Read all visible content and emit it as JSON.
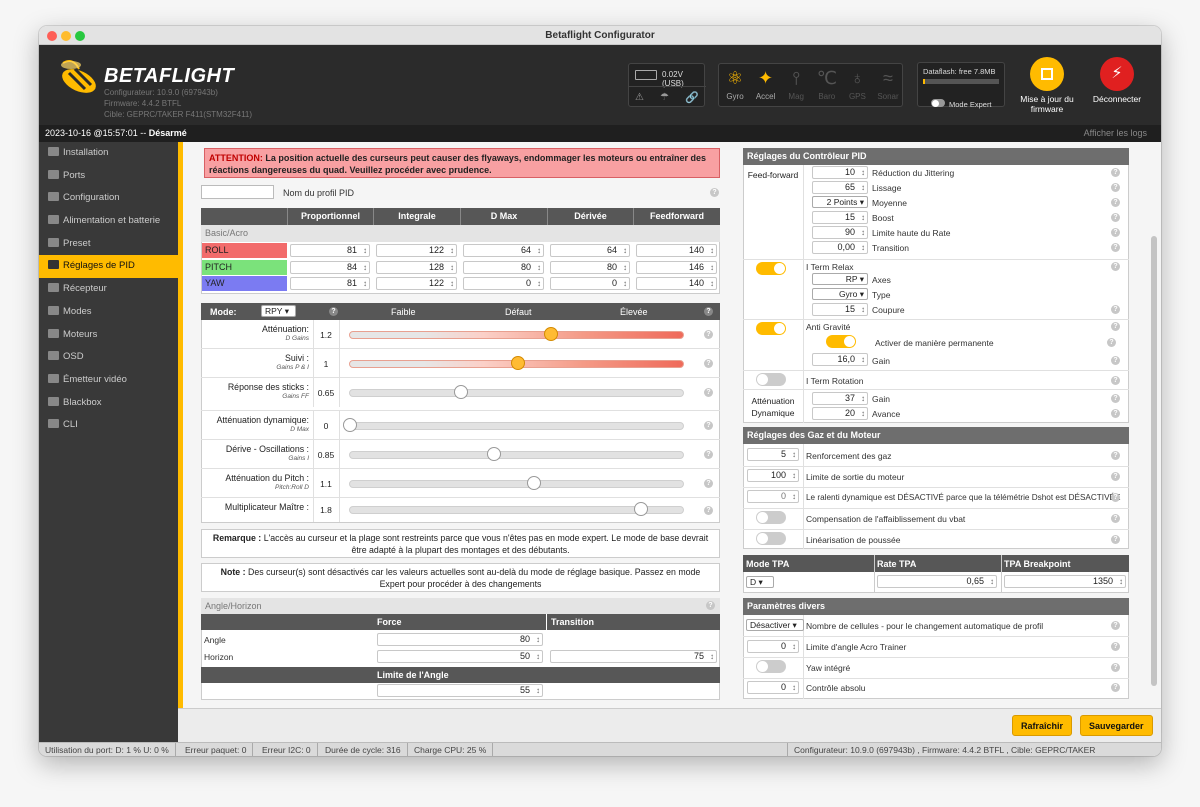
{
  "window": {
    "title": "Betaflight Configurator"
  },
  "header": {
    "logo": "BETAFLIGHT",
    "configurator": "Configurateur: 10.9.0 (697943b)",
    "firmware": "Firmware: 4.4.2 BTFL",
    "target": "Cible: GEPRC/TAKER F411(STM32F411)",
    "battery": "0.02V (USB)",
    "sensors": [
      {
        "label": "Gyro",
        "icon": "gyro-icon",
        "active": true
      },
      {
        "label": "Accel",
        "icon": "accel-icon",
        "active": true
      },
      {
        "label": "Mag",
        "icon": "mag-icon",
        "active": false
      },
      {
        "label": "Baro",
        "icon": "baro-icon",
        "active": false
      },
      {
        "label": "GPS",
        "icon": "gps-icon",
        "active": false
      },
      {
        "label": "Sonar",
        "icon": "sonar-icon",
        "active": false
      }
    ],
    "dataflash": "Dataflash: free 7.8MB",
    "expert_mode": "Mode Expert",
    "firmware_update": "Mise à jour du firmware",
    "disconnect": "Déconnecter",
    "colors": {
      "accent": "#ffbb00",
      "disconnect": "#e02020"
    }
  },
  "status": {
    "datetime": "2023-10-16 @15:57:01",
    "sep": " -- ",
    "state": "Désarmé",
    "show_logs": "Afficher les logs"
  },
  "sidebar": {
    "items": [
      {
        "label": "Installation",
        "active": false
      },
      {
        "label": "Ports",
        "active": false
      },
      {
        "label": "Configuration",
        "active": false
      },
      {
        "label": "Alimentation et batterie",
        "active": false
      },
      {
        "label": "Preset",
        "active": false
      },
      {
        "label": "Réglages de PID",
        "active": true
      },
      {
        "label": "Récepteur",
        "active": false
      },
      {
        "label": "Modes",
        "active": false
      },
      {
        "label": "Moteurs",
        "active": false
      },
      {
        "label": "OSD",
        "active": false
      },
      {
        "label": "Émetteur vidéo",
        "active": false
      },
      {
        "label": "Blackbox",
        "active": false
      },
      {
        "label": "CLI",
        "active": false
      }
    ]
  },
  "pid": {
    "warning_prefix": "ATTENTION:",
    "warning_text": " La position actuelle des curseurs peut causer des flyaways, endommager les moteurs ou entraîner des réactions dangereuses du quad. Veuillez procéder avec prudence.",
    "profile_name_label": "Nom du profil PID",
    "profile_name_value": "",
    "columns": [
      "Proportionnel",
      "Integrale",
      "D Max",
      "Dérivée",
      "Feedforward"
    ],
    "group": "Basic/Acro",
    "rows": [
      {
        "axis": "ROLL",
        "color": "#f26b6b",
        "values": [
          "81",
          "122",
          "64",
          "64",
          "140"
        ]
      },
      {
        "axis": "PITCH",
        "color": "#7be27b",
        "values": [
          "84",
          "128",
          "80",
          "80",
          "146"
        ]
      },
      {
        "axis": "YAW",
        "color": "#7b7bf2",
        "values": [
          "81",
          "122",
          "0",
          "0",
          "140"
        ]
      }
    ],
    "slider_header": {
      "mode_label": "Mode:",
      "mode_value": "RPY",
      "low": "Faible",
      "default": "Défaut",
      "high": "Élevée"
    },
    "sliders": [
      {
        "title": "Atténuation:",
        "sub": "D Gains",
        "value": "1.2",
        "pos": 0.6,
        "active": true
      },
      {
        "title": "Suivi :",
        "sub": "Gains P & I",
        "value": "1",
        "pos": 0.5,
        "active": true
      },
      {
        "title": "Réponse des sticks :",
        "sub": "Gains FF",
        "value": "0.65",
        "pos": 0.33,
        "active": false
      },
      {
        "title": "Atténuation dynamique:",
        "sub": "D Max",
        "value": "0",
        "pos": 0.0,
        "active": false
      },
      {
        "title": "Dérive - Oscillations :",
        "sub": "Gains I",
        "value": "0.85",
        "pos": 0.43,
        "active": false
      },
      {
        "title": "Atténuation du Pitch :",
        "sub": "Pitch:Roll D",
        "value": "1.1",
        "pos": 0.55,
        "active": false
      },
      {
        "title": "Multiplicateur Maître :",
        "sub": "",
        "value": "1.8",
        "pos": 0.87,
        "active": false
      }
    ],
    "note1_label": "Remarque :",
    "note1": " L'accès au curseur et la plage sont restreints parce que vous n'êtes pas en mode expert. Le mode de base devrait être adapté à la plupart des montages et des débutants.",
    "note2_label": "Note :",
    "note2": " Des curseur(s) sont désactivés car les valeurs actuelles sont au-delà du mode de réglage basique. Passez en mode Expert pour procéder à des changements",
    "angle": {
      "title": "Angle/Horizon",
      "force": "Force",
      "transition": "Transition",
      "angle_label": "Angle",
      "horizon_label": "Horizon",
      "angle_force": "80",
      "horizon_force": "50",
      "horizon_transition": "75",
      "limit_label": "Limite de l'Angle",
      "limit_value": "55"
    }
  },
  "controller": {
    "title": "Réglages du Contrôleur PID",
    "feedforward_label": "Feed-forward",
    "ff": [
      {
        "value": "10",
        "label": "Réduction du Jittering"
      },
      {
        "value": "65",
        "label": "Lissage"
      },
      {
        "value": "2 Points",
        "label": "Moyenne",
        "select": true
      },
      {
        "value": "15",
        "label": "Boost"
      },
      {
        "value": "90",
        "label": "Limite haute du Rate"
      },
      {
        "value": "0,00",
        "label": "Transition"
      }
    ],
    "iterm_relax": "I Term Relax",
    "axes_value": "RP",
    "axes_label": "Axes",
    "type_value": "Gyro",
    "type_label": "Type",
    "cutoff_value": "15",
    "cutoff_label": "Coupure",
    "anti_gravity": "Anti Gravité",
    "permanent": "Activer de manière permanente",
    "ag_gain": "16,0",
    "gain_label": "Gain",
    "iterm_rotation": "I Term Rotation",
    "dyn_label": "Atténuation Dynamique",
    "dyn_gain": "37",
    "dyn_gain_label": "Gain",
    "dyn_advance": "20",
    "dyn_advance_label": "Avance"
  },
  "throttle": {
    "title": "Réglages des Gaz et du Moteur",
    "boost": "5",
    "boost_label": "Renforcement des gaz",
    "limit": "100",
    "limit_label": "Limite de sortie du moteur",
    "idle": "0",
    "idle_label": "Le ralenti dynamique est DÉSACTIVÉ parce que la télémétrie Dshot est DÉSACTIVÉE",
    "vbat_label": "Compensation de l'affaiblissement du vbat",
    "thrust_label": "Linéarisation de poussée"
  },
  "tpa": {
    "mode_h": "Mode TPA",
    "rate_h": "Rate TPA",
    "bp_h": "TPA Breakpoint",
    "mode_v": "D",
    "rate_v": "0,65",
    "bp_v": "1350"
  },
  "misc": {
    "title": "Paramètres divers",
    "cells_v": "Désactiver",
    "cells_label": "Nombre de cellules - pour le changement automatique de profil",
    "acro_v": "0",
    "acro_label": "Limite d'angle Acro Trainer",
    "yaw_label": "Yaw intégré",
    "abs_v": "0",
    "abs_label": "Contrôle absolu"
  },
  "footer": {
    "refresh": "Rafraîchir",
    "save": "Sauvegarder"
  },
  "bottom": {
    "port": "Utilisation du port: D: 1 % U: 0 %",
    "packet": "Erreur paquet: 0",
    "i2c": "Erreur I2C: 0",
    "cycle": "Durée de cycle: 316",
    "cpu": "Charge CPU: 25 %",
    "version": "Configurateur: 10.9.0 (697943b) , Firmware: 4.4.2 BTFL , Cible: GEPRC/TAKER F411(STM32F411)"
  }
}
